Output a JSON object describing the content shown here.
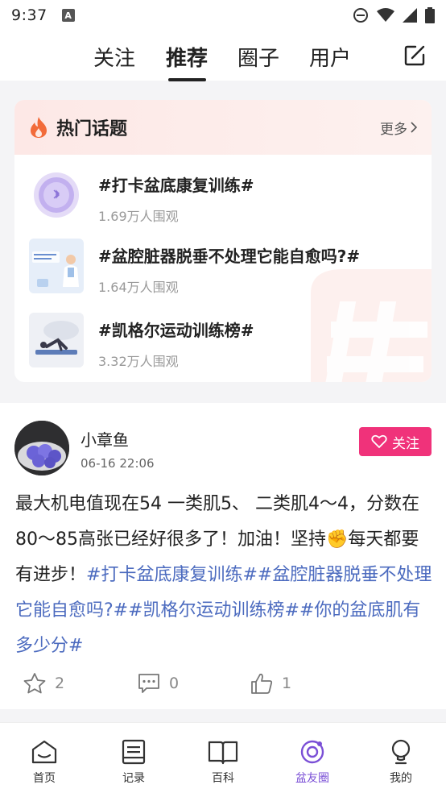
{
  "status_bar": {
    "time": "9:37"
  },
  "top_nav": {
    "tabs": [
      {
        "label": "关注"
      },
      {
        "label": "推荐"
      },
      {
        "label": "圈子"
      },
      {
        "label": "用户"
      }
    ],
    "active_tab": "推荐"
  },
  "hot_topics": {
    "title": "热门话题",
    "more_label": "更多",
    "items": [
      {
        "title": "#打卡盆底康复训练#",
        "views": "1.69万人围观",
        "thumb_icon": "bluetooth-device-thumb"
      },
      {
        "title": "#盆腔脏器脱垂不处理它能自愈吗?#",
        "views": "1.64万人围观",
        "thumb_icon": "doctor-illustration-thumb"
      },
      {
        "title": "#凯格尔运动训练榜#",
        "views": "3.32万人围观",
        "thumb_icon": "exercise-illustration-thumb"
      }
    ]
  },
  "post": {
    "username": "小章鱼",
    "time": "06-16 22:06",
    "follow_label": "关注",
    "text_plain": "最大机电值现在54 一类肌5、 二类肌4～4，分数在80～85高张已经好很多了！加油！坚持✊每天都要有进步！",
    "tags": "#打卡盆底康复训练##盆腔脏器脱垂不处理它能自愈吗?##凯格尔运动训练榜##你的盆底肌有多少分#",
    "stars": "2",
    "comments": "0",
    "likes": "1"
  },
  "bottom_nav": {
    "items": [
      {
        "label": "首页",
        "icon": "home-icon"
      },
      {
        "label": "记录",
        "icon": "record-icon"
      },
      {
        "label": "百科",
        "icon": "book-icon"
      },
      {
        "label": "盆友圈",
        "icon": "circle-icon"
      },
      {
        "label": "我的",
        "icon": "profile-icon"
      }
    ],
    "active": "盆友圈"
  },
  "colors": {
    "accent_pink": "#f0327a",
    "tag_blue": "#4c6bbf",
    "active_purple": "#7a4fd6",
    "fire_orange": "#f26b3a"
  }
}
